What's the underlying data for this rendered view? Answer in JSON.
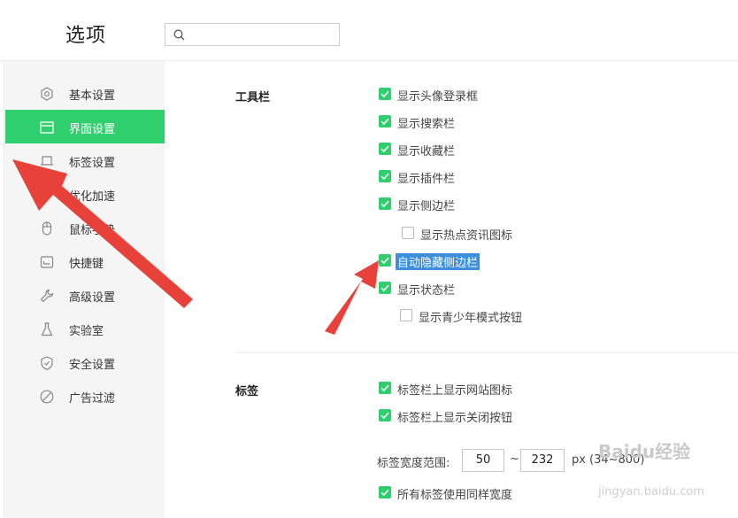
{
  "header": {
    "title": "选项",
    "search_value": "",
    "search_placeholder": ""
  },
  "sidebar": {
    "items": [
      {
        "label": "基本设置",
        "icon": "gear-icon",
        "active": false
      },
      {
        "label": "界面设置",
        "icon": "window-icon",
        "active": true
      },
      {
        "label": "标签设置",
        "icon": "tab-icon",
        "active": false
      },
      {
        "label": "优化加速",
        "icon": "lightning-icon",
        "active": false
      },
      {
        "label": "鼠标手势",
        "icon": "mouse-icon",
        "active": false
      },
      {
        "label": "快捷键",
        "icon": "keyboard-icon",
        "active": false
      },
      {
        "label": "高级设置",
        "icon": "wrench-icon",
        "active": false
      },
      {
        "label": "实验室",
        "icon": "flask-icon",
        "active": false
      },
      {
        "label": "安全设置",
        "icon": "shield-icon",
        "active": false
      },
      {
        "label": "广告过滤",
        "icon": "block-icon",
        "active": false
      }
    ]
  },
  "toolbar_section": {
    "title": "工具栏",
    "options": [
      {
        "label": "显示头像登录框",
        "checked": true
      },
      {
        "label": "显示搜索栏",
        "checked": true
      },
      {
        "label": "显示收藏栏",
        "checked": true
      },
      {
        "label": "显示插件栏",
        "checked": true
      },
      {
        "label": "显示侧边栏",
        "checked": true
      },
      {
        "label": "显示热点资讯图标",
        "checked": false
      },
      {
        "label": "自动隐藏侧边栏",
        "checked": true
      },
      {
        "label": "显示状态栏",
        "checked": true
      },
      {
        "label": "显示青少年模式按钮",
        "checked": false
      }
    ]
  },
  "tabs_section": {
    "title": "标签",
    "options": [
      {
        "label": "标签栏上显示网站图标",
        "checked": true
      },
      {
        "label": "标签栏上显示关闭按钮",
        "checked": true
      }
    ],
    "width_range": {
      "label": "标签宽度范围:",
      "min": "50",
      "separator": "~",
      "max": "232",
      "unit": "px",
      "hint": "(34~800)"
    },
    "same_width": {
      "label": "所有标签使用同样宽度",
      "checked": true
    }
  },
  "watermark": {
    "text": "Baidu经验",
    "url_text": "jingyan.baidu.com"
  },
  "colors": {
    "accent": "#2ecf6c",
    "highlight": "#3b8fdc",
    "arrow": "#e8413a"
  }
}
